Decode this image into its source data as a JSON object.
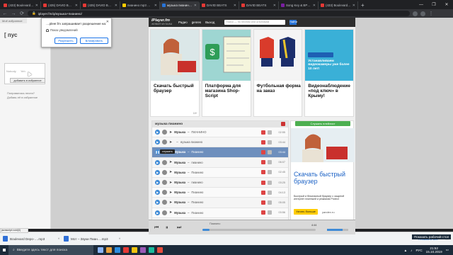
{
  "browser": {
    "tabs": [
      {
        "title": "(433) Boulevard Depo — DRUF",
        "color": "#e53935",
        "active": false
      },
      {
        "title": "(435) DAVID BEATS - YouTube",
        "color": "#e53935",
        "active": false
      },
      {
        "title": "(435) DAVID BEATS",
        "color": "#e53935",
        "active": false
      },
      {
        "title": "пианино mp3 — Яндекс: нашлось",
        "color": "#ffcc00",
        "active": false
      },
      {
        "title": "музыка пианино скачать б…",
        "color": "#2874d9",
        "active": true
      },
      {
        "title": "DAVID BEATS",
        "color": "#e53935",
        "active": false
      },
      {
        "title": "DAVID BEATS",
        "color": "#e53935",
        "active": false
      },
      {
        "title": "Song Key & BPM Finder | Tunebat",
        "color": "#7b1fa2",
        "active": false
      },
      {
        "title": "(433) Boulevard Depo",
        "color": "#e53935",
        "active": false
      }
    ],
    "url": "iplayer.fm/q/музыка+пианино/",
    "window_controls": [
      "—",
      "❐",
      "✕"
    ]
  },
  "left_panel": {
    "tab_label": "Моё избранное",
    "title": "[ пус",
    "box_text_1": "Nobody",
    "box_text_2": "Yeh",
    "add_button": "добавить в избранное",
    "note_1": "Понравилась песня?",
    "note_2": "Добавь её в избранное"
  },
  "permission_popup": {
    "title": "…pleer.fm запрашивает разрешение на:",
    "row": "Показ уведомлений",
    "allow": "Разрешить",
    "block": "Блокировать"
  },
  "site": {
    "logo_main": "IPlayer.fm",
    "logo_sub": "ЖИВАЯ МУЗЫКА",
    "nav": [
      "Радио",
      "genres",
      "Выход"
    ],
    "search_placeholder": "Поиск — по песням или альбомам",
    "search_button": "Найти",
    "ads": [
      {
        "caption": "Скачать быстрый браузер",
        "age": "18+",
        "kind": "browser"
      },
      {
        "caption": "Платформа для магазина Shop-Script",
        "age": "",
        "kind": "shop"
      },
      {
        "caption": "Футбольная форма на заказ",
        "age": "",
        "kind": "kits"
      },
      {
        "caption": "Видеонаблюдение «под ключ» в Крыму!",
        "age": "",
        "kind": "video",
        "overlay": "Устанавливаем видеокамеры уже более 10 лет!"
      }
    ],
    "list_title": "музыка пианино",
    "tracks": [
      {
        "artist": "Музыка",
        "title": "ПИАНИНО",
        "duration": "02:55",
        "playing": false
      },
      {
        "artist": "",
        "title": "музыка пианино",
        "duration": "03:44",
        "playing": false
      },
      {
        "artist": "Музыка",
        "title": "Пианино",
        "duration": "03:44",
        "playing": true
      },
      {
        "artist": "Музыка",
        "title": "пианино",
        "duration": "06:07",
        "playing": false
      },
      {
        "artist": "Музыка",
        "title": "Пианино",
        "duration": "02:45",
        "playing": false
      },
      {
        "artist": "Музыка",
        "title": "пианино",
        "duration": "03:25",
        "playing": false
      },
      {
        "artist": "Музыка",
        "title": "Пианино",
        "duration": "04:13",
        "playing": false
      },
      {
        "artist": "Музыка",
        "title": "Пианино",
        "duration": "05:05",
        "playing": false
      },
      {
        "artist": "Музыка",
        "title": "Пианино",
        "duration": "03:56",
        "playing": false
      },
      {
        "artist": "Музыка",
        "title": "Пианино",
        "duration": "02:39",
        "playing": false
      }
    ],
    "tooltip": "слушать",
    "sideblock": {
      "green_button": "Слушать плейлист",
      "title": "Скачать быстрый браузер",
      "desc": "Быстрый и безопасный браузер с защитой интернет платежей и режимом Protect",
      "button": "Узнать больше",
      "yandex": "yandex.ru",
      "tabs": [
        "Поп",
        "Рок",
        "Классика"
      ]
    }
  },
  "audio_player": {
    "track": "Пианино",
    "time": "4:44",
    "progress": 0.06,
    "volume": 0.73
  },
  "status_url": "javascript:void(0)",
  "downloads": {
    "items": [
      "Boulevard Depo-….mp3",
      "Мот – Звуки Пиан….mp3"
    ],
    "show_all": "Показать все",
    "close": "✕"
  },
  "taskbar": {
    "search": "Введите здесь текст для поиска",
    "lang": "РУС",
    "time": "21:52",
    "date": "15.10.2019",
    "toast": "Показать рабочий стол"
  }
}
